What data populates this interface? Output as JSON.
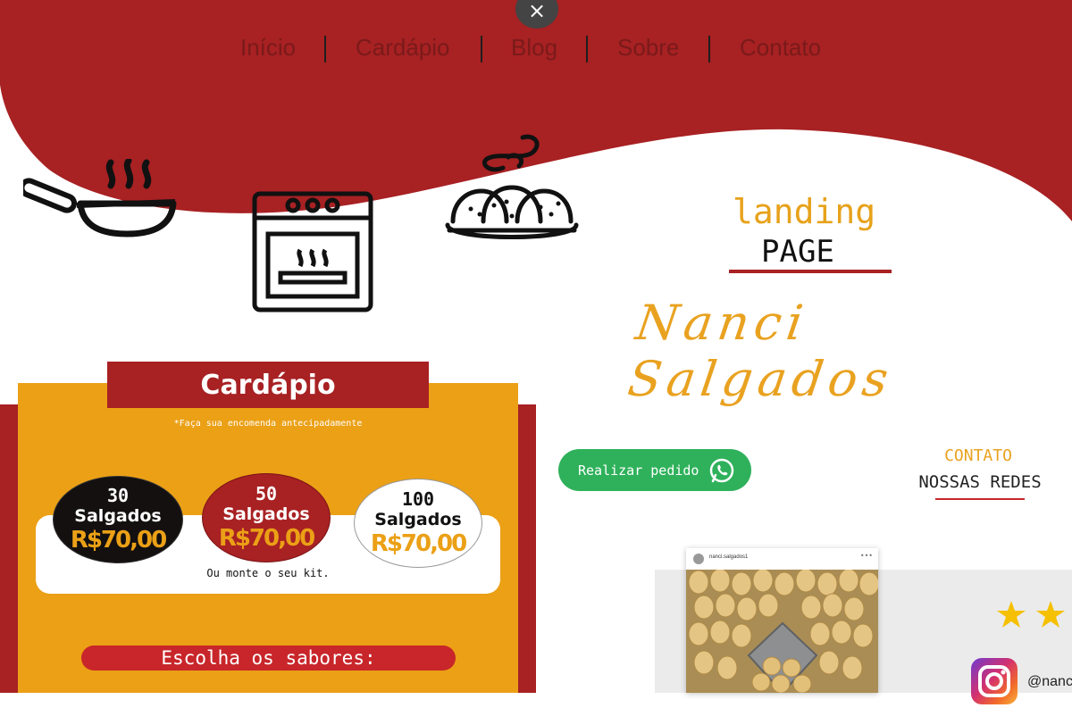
{
  "close": {
    "symbol": "×"
  },
  "nav": {
    "items": [
      "Início",
      "Cardápio",
      "Blog",
      "Sobre",
      "Contato"
    ]
  },
  "brand": {
    "line1": "landing",
    "line2": "PAGE",
    "name": "Nanci Salgados"
  },
  "icons": {
    "pan": "frying-pan-icon",
    "oven": "oven-icon",
    "platter": "snacks-platter-icon",
    "whatsapp": "whatsapp-icon",
    "instagram": "instagram-icon",
    "star": "star-icon"
  },
  "menu_card": {
    "title": "Cardápio",
    "subtitle": "*Faça sua encomenda antecipadamente",
    "packages": [
      {
        "qty": "30",
        "label": "Salgados",
        "price": "R$70,00"
      },
      {
        "qty": "50",
        "label": "Salgados",
        "price": "R$70,00"
      },
      {
        "qty": "100",
        "label": "Salgados",
        "price": "R$70,00"
      }
    ],
    "kit_text": "Ou monte o seu kit.",
    "choose_flavors": "Escolha os sabores:"
  },
  "order": {
    "button_label": "Realizar pedido"
  },
  "contact": {
    "title": "CONTATO",
    "subtitle": "NOSSAS REDES"
  },
  "social": {
    "post_user": "nanci.salgados1",
    "instagram_handle": "@nanc",
    "stars_visible": 2
  },
  "colors": {
    "brand_red": "#a82123",
    "brand_yellow": "#eba016",
    "whatsapp_green": "#2fb15b",
    "nav_text": "#7a1a1a"
  }
}
